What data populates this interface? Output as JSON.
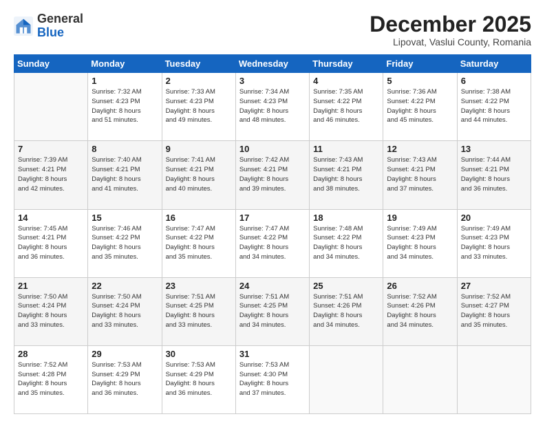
{
  "header": {
    "logo_general": "General",
    "logo_blue": "Blue",
    "month": "December 2025",
    "location": "Lipovat, Vaslui County, Romania"
  },
  "days_of_week": [
    "Sunday",
    "Monday",
    "Tuesday",
    "Wednesday",
    "Thursday",
    "Friday",
    "Saturday"
  ],
  "weeks": [
    [
      {
        "day": "",
        "info": ""
      },
      {
        "day": "1",
        "info": "Sunrise: 7:32 AM\nSunset: 4:23 PM\nDaylight: 8 hours\nand 51 minutes."
      },
      {
        "day": "2",
        "info": "Sunrise: 7:33 AM\nSunset: 4:23 PM\nDaylight: 8 hours\nand 49 minutes."
      },
      {
        "day": "3",
        "info": "Sunrise: 7:34 AM\nSunset: 4:23 PM\nDaylight: 8 hours\nand 48 minutes."
      },
      {
        "day": "4",
        "info": "Sunrise: 7:35 AM\nSunset: 4:22 PM\nDaylight: 8 hours\nand 46 minutes."
      },
      {
        "day": "5",
        "info": "Sunrise: 7:36 AM\nSunset: 4:22 PM\nDaylight: 8 hours\nand 45 minutes."
      },
      {
        "day": "6",
        "info": "Sunrise: 7:38 AM\nSunset: 4:22 PM\nDaylight: 8 hours\nand 44 minutes."
      }
    ],
    [
      {
        "day": "7",
        "info": "Sunrise: 7:39 AM\nSunset: 4:21 PM\nDaylight: 8 hours\nand 42 minutes."
      },
      {
        "day": "8",
        "info": "Sunrise: 7:40 AM\nSunset: 4:21 PM\nDaylight: 8 hours\nand 41 minutes."
      },
      {
        "day": "9",
        "info": "Sunrise: 7:41 AM\nSunset: 4:21 PM\nDaylight: 8 hours\nand 40 minutes."
      },
      {
        "day": "10",
        "info": "Sunrise: 7:42 AM\nSunset: 4:21 PM\nDaylight: 8 hours\nand 39 minutes."
      },
      {
        "day": "11",
        "info": "Sunrise: 7:43 AM\nSunset: 4:21 PM\nDaylight: 8 hours\nand 38 minutes."
      },
      {
        "day": "12",
        "info": "Sunrise: 7:43 AM\nSunset: 4:21 PM\nDaylight: 8 hours\nand 37 minutes."
      },
      {
        "day": "13",
        "info": "Sunrise: 7:44 AM\nSunset: 4:21 PM\nDaylight: 8 hours\nand 36 minutes."
      }
    ],
    [
      {
        "day": "14",
        "info": "Sunrise: 7:45 AM\nSunset: 4:21 PM\nDaylight: 8 hours\nand 36 minutes."
      },
      {
        "day": "15",
        "info": "Sunrise: 7:46 AM\nSunset: 4:22 PM\nDaylight: 8 hours\nand 35 minutes."
      },
      {
        "day": "16",
        "info": "Sunrise: 7:47 AM\nSunset: 4:22 PM\nDaylight: 8 hours\nand 35 minutes."
      },
      {
        "day": "17",
        "info": "Sunrise: 7:47 AM\nSunset: 4:22 PM\nDaylight: 8 hours\nand 34 minutes."
      },
      {
        "day": "18",
        "info": "Sunrise: 7:48 AM\nSunset: 4:22 PM\nDaylight: 8 hours\nand 34 minutes."
      },
      {
        "day": "19",
        "info": "Sunrise: 7:49 AM\nSunset: 4:23 PM\nDaylight: 8 hours\nand 34 minutes."
      },
      {
        "day": "20",
        "info": "Sunrise: 7:49 AM\nSunset: 4:23 PM\nDaylight: 8 hours\nand 33 minutes."
      }
    ],
    [
      {
        "day": "21",
        "info": "Sunrise: 7:50 AM\nSunset: 4:24 PM\nDaylight: 8 hours\nand 33 minutes."
      },
      {
        "day": "22",
        "info": "Sunrise: 7:50 AM\nSunset: 4:24 PM\nDaylight: 8 hours\nand 33 minutes."
      },
      {
        "day": "23",
        "info": "Sunrise: 7:51 AM\nSunset: 4:25 PM\nDaylight: 8 hours\nand 33 minutes."
      },
      {
        "day": "24",
        "info": "Sunrise: 7:51 AM\nSunset: 4:25 PM\nDaylight: 8 hours\nand 34 minutes."
      },
      {
        "day": "25",
        "info": "Sunrise: 7:51 AM\nSunset: 4:26 PM\nDaylight: 8 hours\nand 34 minutes."
      },
      {
        "day": "26",
        "info": "Sunrise: 7:52 AM\nSunset: 4:26 PM\nDaylight: 8 hours\nand 34 minutes."
      },
      {
        "day": "27",
        "info": "Sunrise: 7:52 AM\nSunset: 4:27 PM\nDaylight: 8 hours\nand 35 minutes."
      }
    ],
    [
      {
        "day": "28",
        "info": "Sunrise: 7:52 AM\nSunset: 4:28 PM\nDaylight: 8 hours\nand 35 minutes."
      },
      {
        "day": "29",
        "info": "Sunrise: 7:53 AM\nSunset: 4:29 PM\nDaylight: 8 hours\nand 36 minutes."
      },
      {
        "day": "30",
        "info": "Sunrise: 7:53 AM\nSunset: 4:29 PM\nDaylight: 8 hours\nand 36 minutes."
      },
      {
        "day": "31",
        "info": "Sunrise: 7:53 AM\nSunset: 4:30 PM\nDaylight: 8 hours\nand 37 minutes."
      },
      {
        "day": "",
        "info": ""
      },
      {
        "day": "",
        "info": ""
      },
      {
        "day": "",
        "info": ""
      }
    ]
  ]
}
